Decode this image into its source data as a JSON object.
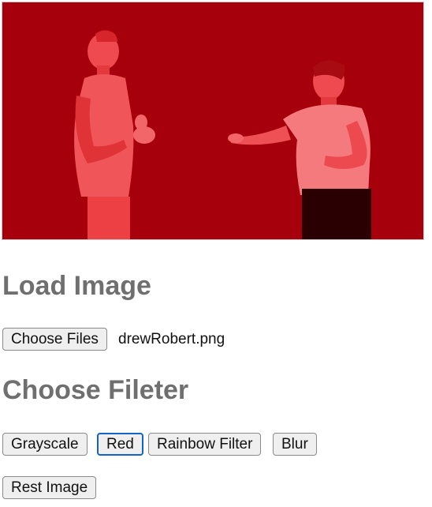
{
  "canvas": {
    "background_color": "#a6000c",
    "filter_applied": "red"
  },
  "load_section": {
    "heading": "Load Image",
    "choose_files_label": "Choose Files",
    "file_name": "drewRobert.png"
  },
  "filter_section": {
    "heading": "Choose Fileter",
    "buttons": {
      "grayscale": "Grayscale",
      "red": "Red",
      "rainbow": "Rainbow Filter",
      "blur": "Blur"
    },
    "focused_button": "red",
    "focus_color": "#1663c7"
  },
  "reset": {
    "label": "Rest Image"
  },
  "colors": {
    "heading_text": "#6f6f6f",
    "button_bg": "#efefef"
  }
}
